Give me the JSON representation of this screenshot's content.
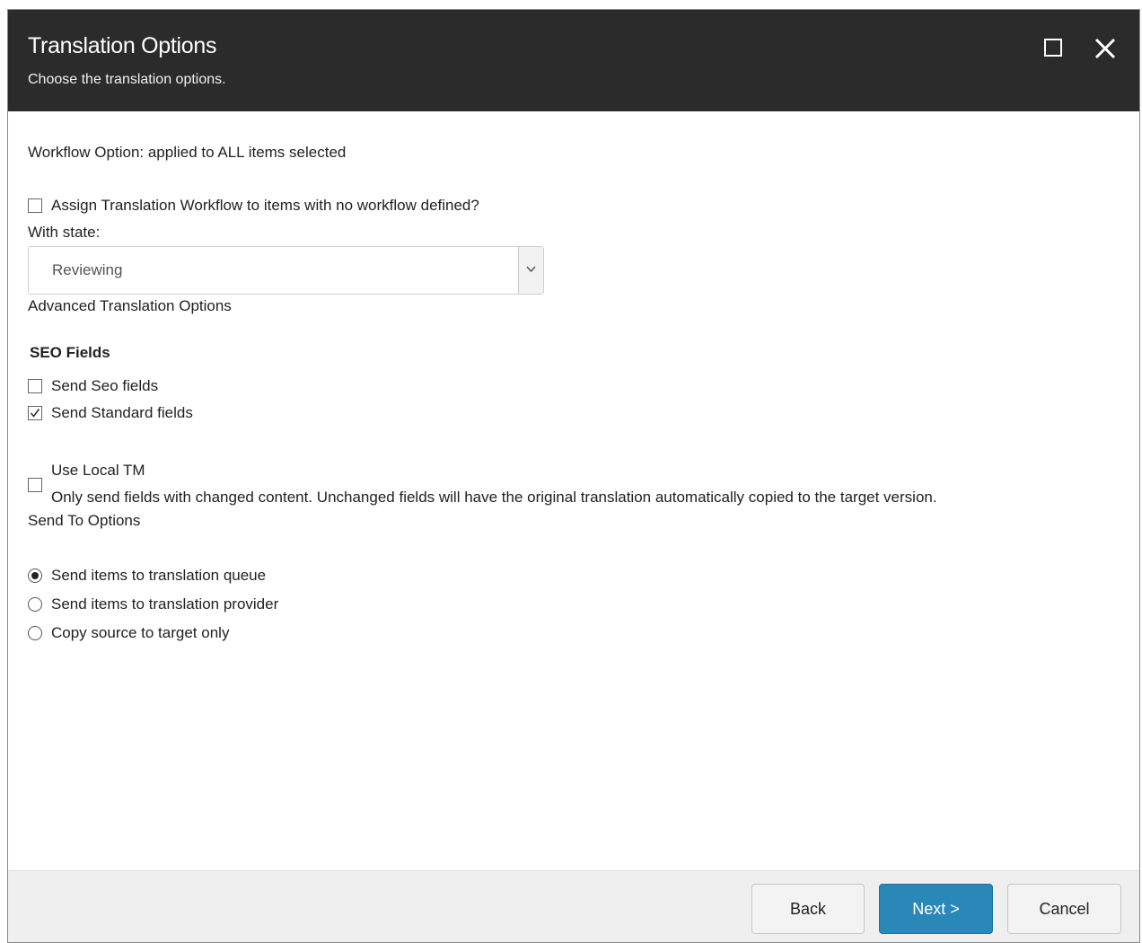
{
  "dialog": {
    "title": "Translation Options",
    "subtitle": "Choose the translation options.",
    "maximize_icon": "maximize-icon",
    "close_icon": "close-icon"
  },
  "workflow": {
    "heading": "Workflow Option: applied to ALL items selected",
    "assign_label": "Assign Translation Workflow to items with no workflow defined?",
    "assign_checked": false,
    "state_label": "With state:",
    "state_value": "Reviewing"
  },
  "advanced": {
    "heading": "Advanced Translation Options",
    "seo_heading": "SEO Fields",
    "send_seo_label": "Send Seo fields",
    "send_seo_checked": false,
    "send_standard_label": "Send Standard fields",
    "send_standard_checked": true,
    "local_tm_title": "Use Local TM",
    "local_tm_desc": "Only send fields with changed content. Unchanged fields will have the original translation automatically copied to the target version.",
    "local_tm_checked": false
  },
  "send_to": {
    "heading": "Send To Options",
    "options": [
      {
        "label": "Send items to translation queue",
        "selected": true
      },
      {
        "label": "Send items to translation provider",
        "selected": false
      },
      {
        "label": "Copy source to target only",
        "selected": false
      }
    ]
  },
  "footer": {
    "back_label": "Back",
    "next_label": "Next >",
    "cancel_label": "Cancel"
  },
  "colors": {
    "titlebar": "#2b2b2b",
    "primary_button": "#2a88b9",
    "footer_bg": "#efefef"
  }
}
